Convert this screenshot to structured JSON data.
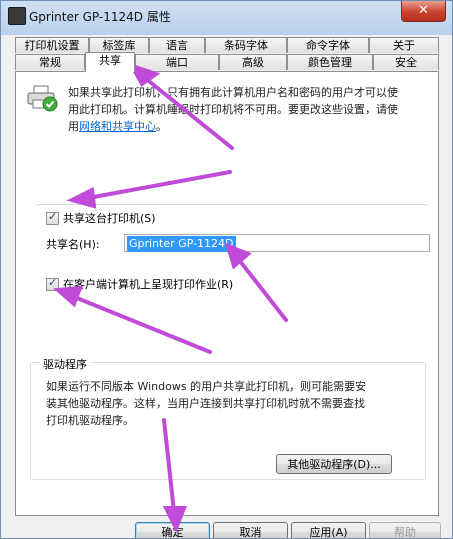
{
  "window": {
    "title": "Gprinter  GP-1124D 属性",
    "close_label": "✕"
  },
  "tabs": {
    "row_top": [
      "打印机设置",
      "标签库",
      "语言",
      "条码字体",
      "命令字体",
      "关于"
    ],
    "row_bottom": [
      "常规",
      "共享",
      "端口",
      "高级",
      "颜色管理",
      "安全"
    ],
    "active": "共享"
  },
  "sharing": {
    "intro_line1": "如果共享此打印机，只有拥有此计算机用户名和密码的用户才可以使",
    "intro_line2": "用此打印机。计算机睡眠时打印机将不可用。要更改这些设置，请使",
    "intro_prefix": "用",
    "intro_link": "网络和共享中心",
    "intro_suffix": "。",
    "share_checkbox_label": "共享这台打印机(S)",
    "share_name_label": "共享名(H):",
    "share_name_value": "Gprinter  GP-1124D",
    "render_jobs_label": "在客户端计算机上呈现打印作业(R)"
  },
  "drivers": {
    "title": "驱动程序",
    "desc_line1": "如果运行不同版本 Windows 的用户共享此打印机，则可能需要安",
    "desc_line2": "装其他驱动程序。这样，当用户连接到共享打印机时就不需要查找",
    "desc_line3": "打印机驱动程序。",
    "other_drivers_button": "其他驱动程序(D)..."
  },
  "footer": {
    "ok": "确定",
    "cancel": "取消",
    "apply": "应用(A)",
    "help": "帮助"
  },
  "colors": {
    "accent": "#3399ff",
    "annotation": "#c04bd8",
    "link": "#0066cc"
  },
  "icons": [
    "printer-icon",
    "checkmark-icon",
    "close-icon"
  ]
}
